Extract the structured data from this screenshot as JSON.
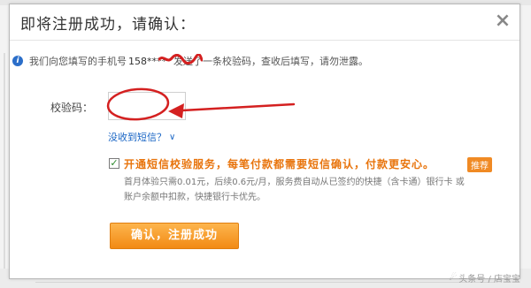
{
  "dialog": {
    "title": "即将注册成功，请确认：",
    "close_glyph": "×"
  },
  "notice": {
    "icon": "info-icon",
    "prefix": "我们向您填写的手机号",
    "phone": "158****",
    "suffix": "发送了一条校验码，查收后填写，请勿泄露。"
  },
  "verify": {
    "label": "校验码：",
    "input_value": "",
    "input_placeholder": ""
  },
  "resend": {
    "text": "没收到短信？",
    "icon": "chevron-down-icon"
  },
  "service": {
    "checked": true,
    "title": "开通短信校验服务，每笔付款都需要短信确认，付款更安心。",
    "badge": "推荐",
    "desc_line1": "首月体验只需0.01元，后续0.6元/月，服务费自动从已签约的快捷（含卡通）银行卡 或",
    "desc_line2": "账户余额中扣款，快捷银行卡优先。"
  },
  "confirm_button": "确认，注册成功",
  "watermark": "头条号 / 店宝宝",
  "annotation_color": "#d42020"
}
